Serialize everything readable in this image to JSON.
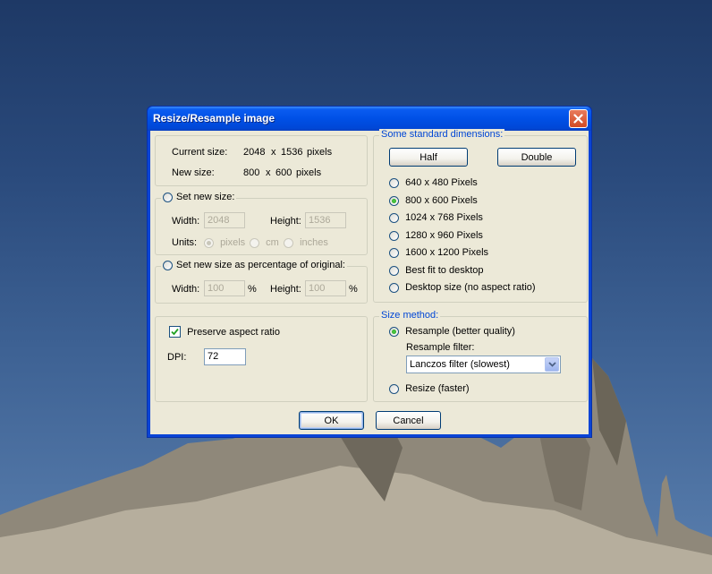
{
  "dialog": {
    "title": "Resize/Resample image",
    "current_size": {
      "label": "Current size:",
      "width": "2048",
      "x": "x",
      "height": "1536",
      "unit": "pixels"
    },
    "new_size": {
      "label": "New size:",
      "width": "800",
      "x": "x",
      "height": "600",
      "unit": "pixels"
    },
    "set_new_size": {
      "label": "Set new size:",
      "width_label": "Width:",
      "width_value": "2048",
      "height_label": "Height:",
      "height_value": "1536",
      "units_label": "Units:",
      "units": [
        "pixels",
        "cm",
        "inches"
      ],
      "selected_unit": "pixels"
    },
    "percentage": {
      "label": "Set new size as percentage of original:",
      "width_label": "Width:",
      "width_value": "100",
      "width_unit": "%",
      "height_label": "Height:",
      "height_value": "100",
      "height_unit": "%"
    },
    "preserve_aspect": {
      "label": "Preserve aspect ratio",
      "checked": true
    },
    "dpi": {
      "label": "DPI:",
      "value": "72"
    },
    "standard": {
      "label": "Some standard dimensions:",
      "half": "Half",
      "double": "Double",
      "options": [
        "640 x 480 Pixels",
        "800 x 600 Pixels",
        "1024 x 768 Pixels",
        "1280 x 960 Pixels",
        "1600 x 1200 Pixels",
        "Best fit to desktop",
        "Desktop size (no aspect ratio)"
      ],
      "selected": "800 x 600 Pixels"
    },
    "method": {
      "label": "Size method:",
      "resample": "Resample (better quality)",
      "filter_label": "Resample filter:",
      "filter_value": "Lanczos filter (slowest)",
      "resize": "Resize (faster)",
      "selected": "resample"
    },
    "ok": "OK",
    "cancel": "Cancel"
  },
  "colors": {
    "titlebar": "#0050e6",
    "close": "#d24a25",
    "face": "#ece9d8",
    "group_label": "#0046d5"
  }
}
